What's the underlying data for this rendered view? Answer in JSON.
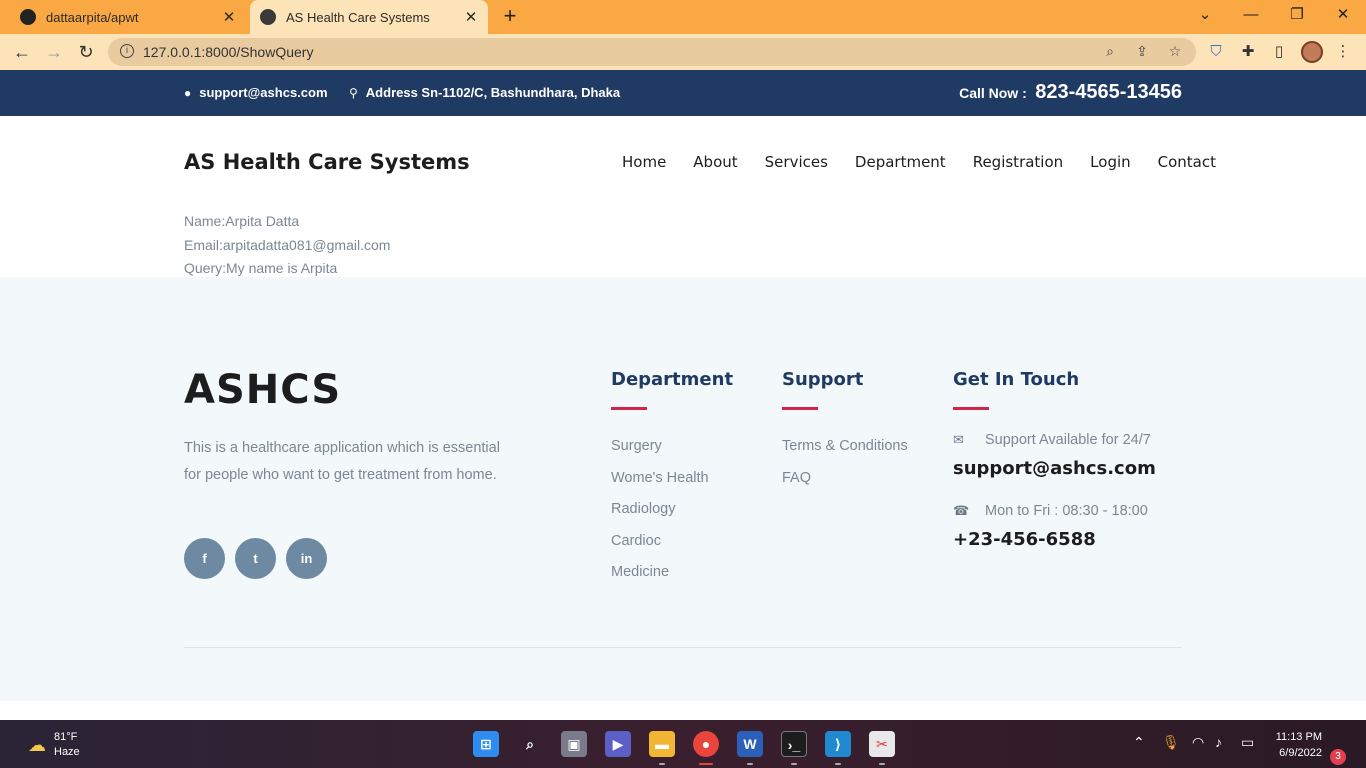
{
  "browser": {
    "tabs": [
      {
        "title": "dattaarpita/apwt",
        "close": "✕"
      },
      {
        "title": "AS Health Care Systems",
        "close": "✕"
      }
    ],
    "new_tab": "+",
    "url": "127.0.0.1:8000/ShowQuery"
  },
  "topbar": {
    "email": "support@ashcs.com",
    "address": "Address Sn-1102/C, Bashundhara, Dhaka",
    "call_label": "Call Now :",
    "phone": "823-4565-13456"
  },
  "header": {
    "brand": "AS Health Care Systems",
    "nav": [
      "Home",
      "About",
      "Services",
      "Department",
      "Registration",
      "Login",
      "Contact"
    ]
  },
  "query": {
    "name": "Name:Arpita Datta",
    "email": "Email:arpitadatta081@gmail.com",
    "query": "Query:My name is Arpita"
  },
  "footer": {
    "logo": "ASHCS",
    "description": "This is a healthcare application which is essential for people who want to get treatment from home.",
    "socials": [
      "f",
      "t",
      "in"
    ],
    "department": {
      "title": "Department",
      "links": [
        "Surgery",
        "Wome's Health",
        "Radiology",
        "Cardioc",
        "Medicine"
      ]
    },
    "support": {
      "title": "Support",
      "links": [
        "Terms & Conditions",
        "FAQ"
      ]
    },
    "contact": {
      "title": "Get In Touch",
      "support_label": "Support Available for 24/7",
      "email": "support@ashcs.com",
      "hours_label": "Mon to Fri : 08:30 - 18:00",
      "phone": "+23-456-6588"
    }
  },
  "taskbar": {
    "temperature": "81°F",
    "condition": "Haze",
    "time": "11:13 PM",
    "date": "6/9/2022",
    "notifications": "3",
    "apps": [
      "start-icon",
      "search-icon",
      "task-view-icon",
      "meet-icon",
      "file-explorer-icon",
      "chrome-icon",
      "word-icon",
      "terminal-icon",
      "vscode-icon",
      "snipping-tool-icon"
    ]
  },
  "colors": {
    "tabbar": "#f9a843",
    "topbar": "#1f3a63",
    "accent": "#d1254b",
    "footer_bg": "#f3f8fa"
  }
}
